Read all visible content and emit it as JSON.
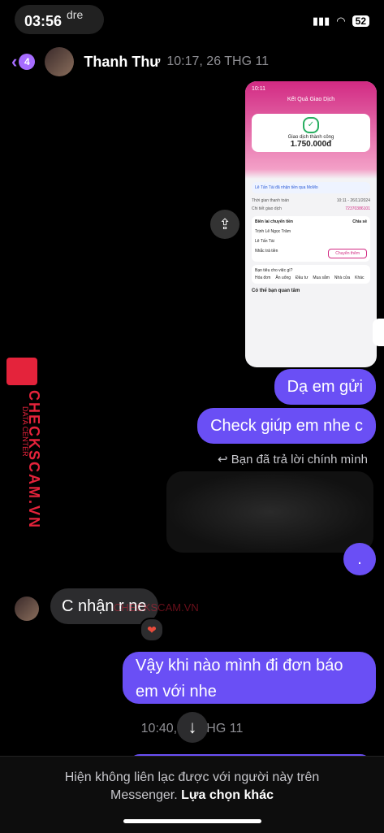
{
  "status_bar": {
    "time": "03:56",
    "carrier_hint": "dre",
    "battery": "52"
  },
  "header": {
    "badge": "4",
    "contact": "Thanh Thư",
    "timestamp": "10:17, 26 THG 11"
  },
  "screenshot": {
    "time": "10:11",
    "title": "Kết Quả Giao Dịch",
    "status": "Giao dịch thành công",
    "amount": "1.750.000đ",
    "info": "Lê Tấn Tài đã nhận tiền qua MoMo",
    "time_label": "Thời gian thanh toán",
    "time_value": "10:11 - 26/11/2024",
    "detail_label": "Chi tiết giao dịch",
    "detail_value": "72370386101",
    "receipt": "Biên lai chuyển tiền",
    "share": "Chia sẻ",
    "sender": "Trịnh Lê Ngọc Trâm",
    "receiver": "Lê Tấn Tài",
    "remind": "Nhắc trả tiền",
    "transfer_more": "Chuyển thêm",
    "spend_q": "Bạn tiêu cho việc gì?",
    "cats": [
      "Hóa đơn",
      "Ăn uống",
      "Đầu tư",
      "Mua sắm",
      "Nhà cửa",
      "Khác"
    ],
    "interest": "Có thể bạn quan tâm"
  },
  "messages": {
    "out1": "Dạ em gửi",
    "out2": "Check giúp em nhe c",
    "reply_note": "Bạn đã trả lời chính mình",
    "out3": ".",
    "in1": "C nhận r ne",
    "reaction": "❤",
    "out4_line1": "Vậy khi nào mình đi đơn báo",
    "out4_line2": "em với nhe",
    "time_sep": "10:40, 26 THG 11"
  },
  "footer": {
    "text": "Hiện không liên lạc được với người này trên Messenger.",
    "link": "Lựa chọn khác"
  },
  "watermark": {
    "left": "CHECKSCAM.VN",
    "left_small": "DATA CENTER",
    "center": "CHECKSCAM.VN"
  }
}
